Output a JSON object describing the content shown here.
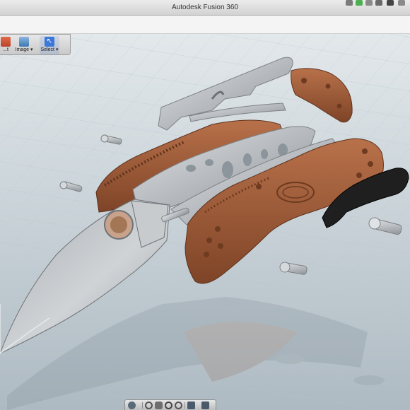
{
  "window": {
    "title": "Autodesk Fusion 360"
  },
  "toolbar": {
    "items": [
      {
        "label": "...t",
        "icon": "inspect-icon"
      },
      {
        "label": "Image",
        "icon": "image-icon",
        "has_dropdown": true
      },
      {
        "label": "Select",
        "icon": "select-arrow-icon",
        "has_dropdown": true,
        "active": true
      }
    ]
  },
  "navbar": {
    "buttons": [
      "move-icon",
      "orbit-icon",
      "pan-hand-icon",
      "zoom-icon",
      "fit-icon",
      "display-settings-icon",
      "grid-settings-icon"
    ]
  },
  "colors": {
    "handle": "#9c5a34",
    "steel": "#b9bcbf",
    "clip": "#1c1c1c",
    "ground": "#c8d2d8",
    "accent": "#3c78d8"
  }
}
